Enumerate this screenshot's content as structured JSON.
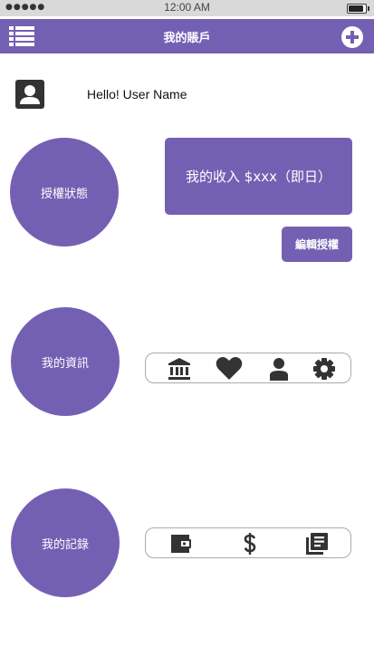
{
  "status_bar": {
    "signal": "●●●●●",
    "time": "12:00 AM"
  },
  "nav": {
    "title": "我的賬戶",
    "menu_icon": "list-icon",
    "add_icon": "plus-circle-icon"
  },
  "profile": {
    "avatar_icon": "user-contact-icon",
    "greeting": "Hello! User Name"
  },
  "sections": {
    "auth_status": "授權狀態",
    "my_info": "我的資訊",
    "my_records": "我的記錄"
  },
  "income_card": {
    "text": "我的收入 $xxx（即日）"
  },
  "edit_auth_button": "編輯授權",
  "info_icons": [
    "bank-icon",
    "heart-icon",
    "person-icon",
    "gear-icon"
  ],
  "record_icons": [
    "wallet-icon",
    "dollar-icon",
    "library-books-icon"
  ],
  "colors": {
    "accent": "#7460b3",
    "icon_dark": "#333333"
  }
}
